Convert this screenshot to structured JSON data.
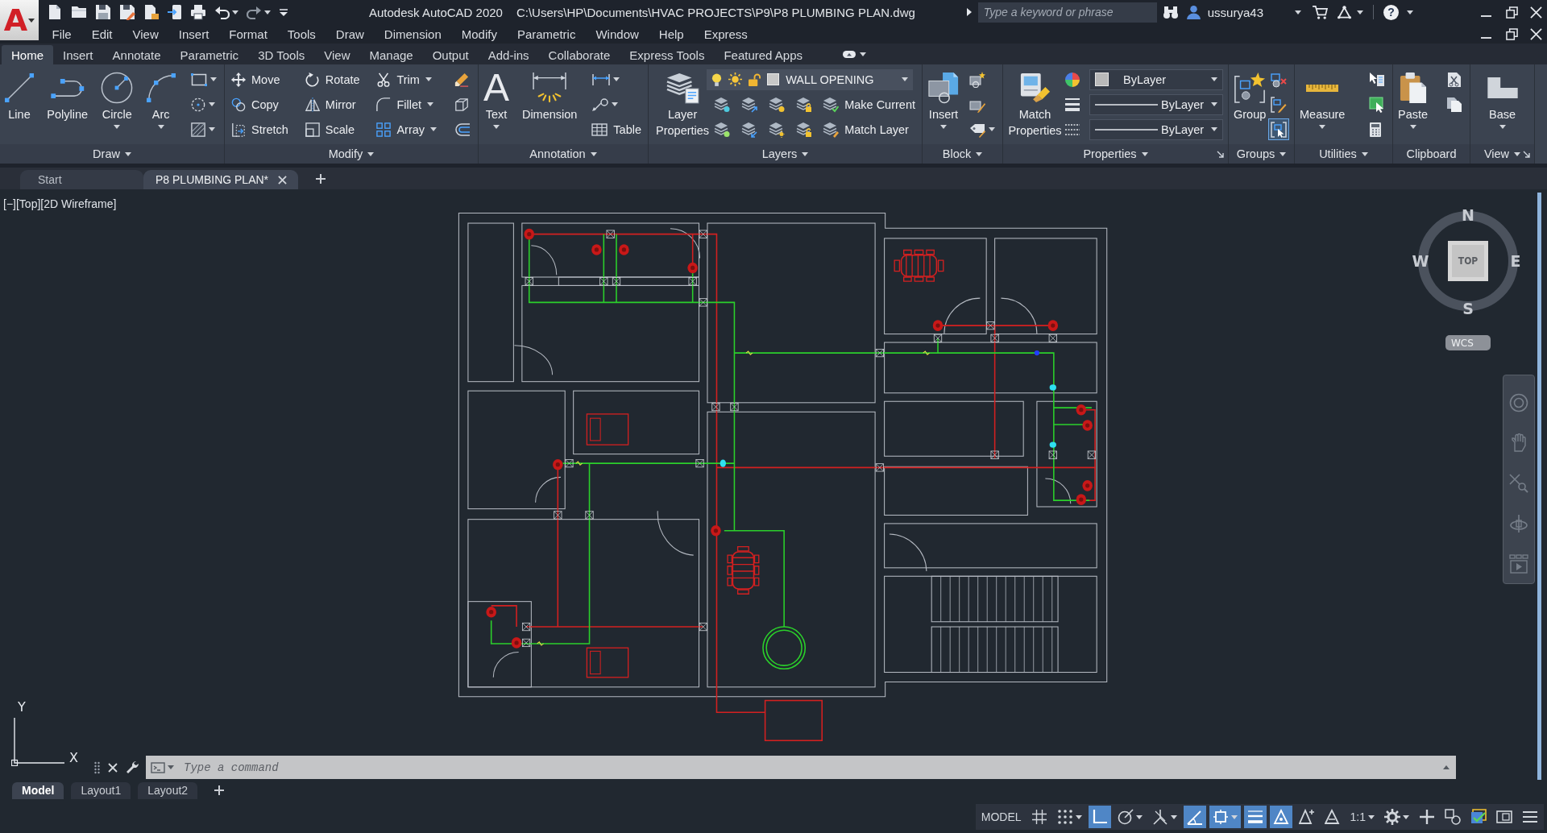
{
  "title_bar": {
    "logo": "A",
    "app_name": "Autodesk AutoCAD 2020",
    "file_path": "C:\\Users\\HP\\Documents\\HVAC PROJECTS\\P9\\P8 PLUMBING PLAN.dwg",
    "search": {
      "placeholder": "Type a keyword or phrase"
    },
    "user": "ussurya43",
    "help": "?"
  },
  "menu_bar": [
    "File",
    "Edit",
    "View",
    "Insert",
    "Format",
    "Tools",
    "Draw",
    "Dimension",
    "Modify",
    "Parametric",
    "Window",
    "Help",
    "Express"
  ],
  "ribbon_tabs": [
    {
      "label": "Home",
      "selected": true
    },
    {
      "label": "Insert",
      "selected": false
    },
    {
      "label": "Annotate",
      "selected": false
    },
    {
      "label": "Parametric",
      "selected": false
    },
    {
      "label": "3D Tools",
      "selected": false
    },
    {
      "label": "View",
      "selected": false
    },
    {
      "label": "Manage",
      "selected": false
    },
    {
      "label": "Output",
      "selected": false
    },
    {
      "label": "Add-ins",
      "selected": false
    },
    {
      "label": "Collaborate",
      "selected": false
    },
    {
      "label": "Express Tools",
      "selected": false
    },
    {
      "label": "Featured Apps",
      "selected": false
    }
  ],
  "ribbon_panels": [
    {
      "title": "Draw",
      "caret": true,
      "launcher": false,
      "columns": [
        {
          "kind": "large",
          "label": "Line",
          "caret": false
        },
        {
          "kind": "large",
          "label": "Polyline",
          "caret": false
        },
        {
          "kind": "large",
          "label": "Circle",
          "caret": true
        },
        {
          "kind": "large",
          "label": "Arc",
          "caret": true
        },
        {
          "kind": "stack",
          "rows": [
            [
              {
                "kind": "icon",
                "caret": true,
                "on": false
              }
            ],
            [
              {
                "kind": "icon",
                "caret": true,
                "on": false
              }
            ],
            [
              {
                "kind": "icon",
                "caret": true,
                "on": false
              }
            ]
          ]
        }
      ]
    },
    {
      "title": "Modify",
      "caret": true,
      "launcher": false,
      "columns": [
        {
          "kind": "stack",
          "rows": [
            [
              {
                "kind": "tool",
                "label": "Move",
                "caret": false
              }
            ],
            [
              {
                "kind": "tool",
                "label": "Copy",
                "caret": false
              }
            ],
            [
              {
                "kind": "tool",
                "label": "Stretch",
                "caret": false
              }
            ]
          ]
        },
        {
          "kind": "stack",
          "rows": [
            [
              {
                "kind": "tool",
                "label": "Rotate",
                "caret": false
              }
            ],
            [
              {
                "kind": "tool",
                "label": "Mirror",
                "caret": false
              }
            ],
            [
              {
                "kind": "tool",
                "label": "Scale",
                "caret": false
              }
            ]
          ]
        },
        {
          "kind": "stack",
          "rows": [
            [
              {
                "kind": "tool",
                "label": "Trim",
                "caret": true
              }
            ],
            [
              {
                "kind": "tool",
                "label": "Fillet",
                "caret": true
              }
            ],
            [
              {
                "kind": "tool",
                "label": "Array",
                "caret": true
              }
            ]
          ]
        },
        {
          "kind": "stack",
          "rows": [
            [
              {
                "kind": "icon",
                "caret": false,
                "on": false
              }
            ],
            [
              {
                "kind": "icon",
                "caret": false,
                "on": false
              }
            ],
            [
              {
                "kind": "icon",
                "caret": false,
                "on": false
              }
            ]
          ]
        }
      ]
    },
    {
      "title": "Annotation",
      "caret": true,
      "launcher": false,
      "columns": [
        {
          "kind": "large",
          "label": "Text",
          "glyph": "A",
          "caret": true
        },
        {
          "kind": "large",
          "label": "Dimension",
          "caret": false
        },
        {
          "kind": "stack",
          "rows": [
            [
              {
                "kind": "icon",
                "caret": true,
                "on": false
              }
            ],
            [
              {
                "kind": "icon",
                "caret": true,
                "on": false
              }
            ],
            [
              {
                "kind": "tool",
                "label": "Table",
                "caret": false
              }
            ]
          ]
        }
      ]
    },
    {
      "title": "Layers",
      "caret": true,
      "launcher": false,
      "columns": [
        {
          "kind": "large",
          "label": "Layer Properties",
          "caret": false
        },
        {
          "kind": "stack",
          "rows": [
            [
              {
                "kind": "combo-layer",
                "value": "WALL OPENING"
              }
            ],
            [
              {
                "kind": "icon",
                "caret": false,
                "on": false
              },
              {
                "kind": "icon",
                "caret": false,
                "on": false
              },
              {
                "kind": "icon",
                "caret": false,
                "on": false
              },
              {
                "kind": "icon",
                "caret": false,
                "on": false
              },
              {
                "kind": "tool",
                "label": "Make Current",
                "caret": false
              }
            ],
            [
              {
                "kind": "icon",
                "caret": false,
                "on": false
              },
              {
                "kind": "icon",
                "caret": false,
                "on": false
              },
              {
                "kind": "icon",
                "caret": false,
                "on": false
              },
              {
                "kind": "icon",
                "caret": false,
                "on": false
              },
              {
                "kind": "tool",
                "label": "Match Layer",
                "caret": false
              }
            ]
          ]
        }
      ]
    },
    {
      "title": "Block",
      "caret": true,
      "launcher": false,
      "columns": [
        {
          "kind": "large",
          "label": "Insert",
          "caret": true
        },
        {
          "kind": "stack",
          "rows": [
            [
              {
                "kind": "icon",
                "caret": false,
                "on": false
              }
            ],
            [
              {
                "kind": "icon",
                "caret": false,
                "on": false
              }
            ],
            [
              {
                "kind": "icon",
                "caret": true,
                "on": false
              }
            ]
          ]
        }
      ]
    },
    {
      "title": "Properties",
      "caret": true,
      "launcher": true,
      "columns": [
        {
          "kind": "large",
          "label": "Match Properties",
          "caret": false
        },
        {
          "kind": "stack",
          "rows": [
            [
              {
                "kind": "icon",
                "caret": false,
                "on": false
              },
              {
                "kind": "combo-swatch",
                "value": "ByLayer"
              }
            ],
            [
              {
                "kind": "icon",
                "caret": false,
                "on": false
              },
              {
                "kind": "combo-line",
                "value": "ByLayer"
              }
            ],
            [
              {
                "kind": "icon",
                "caret": false,
                "on": false
              },
              {
                "kind": "combo-line",
                "value": "ByLayer"
              }
            ]
          ]
        }
      ]
    },
    {
      "title": "Groups",
      "caret": true,
      "launcher": false,
      "columns": [
        {
          "kind": "large",
          "label": "Group",
          "caret": false
        },
        {
          "kind": "stack",
          "rows": [
            [
              {
                "kind": "icon",
                "caret": false,
                "on": false
              }
            ],
            [
              {
                "kind": "icon",
                "caret": false,
                "on": false
              }
            ],
            [
              {
                "kind": "icon",
                "caret": false,
                "on": true
              }
            ]
          ]
        }
      ]
    },
    {
      "title": "Utilities",
      "caret": true,
      "launcher": false,
      "columns": [
        {
          "kind": "large",
          "label": "Measure",
          "caret": true
        },
        {
          "kind": "stack",
          "rows": [
            [
              {
                "kind": "icon",
                "caret": false,
                "on": false
              }
            ],
            [
              {
                "kind": "icon",
                "caret": false,
                "on": false
              }
            ],
            [
              {
                "kind": "icon",
                "caret": false,
                "on": false
              }
            ]
          ]
        }
      ]
    },
    {
      "title": "Clipboard",
      "caret": false,
      "launcher": false,
      "columns": [
        {
          "kind": "large",
          "label": "Paste",
          "caret": true
        },
        {
          "kind": "stack",
          "rows": [
            [
              {
                "kind": "icon",
                "caret": false,
                "on": false
              }
            ],
            [
              {
                "kind": "icon",
                "caret": false,
                "on": false
              }
            ]
          ]
        }
      ]
    },
    {
      "title": "View",
      "caret": true,
      "launcher": true,
      "columns": [
        {
          "kind": "large",
          "label": "Base",
          "caret": true
        }
      ]
    }
  ],
  "file_tabs": [
    {
      "label": "Start",
      "selected": false,
      "closable": false
    },
    {
      "label": "P8 PLUMBING PLAN*",
      "selected": true,
      "closable": true
    }
  ],
  "viewport": {
    "label": "[−][Top][2D Wireframe]",
    "view_cube": {
      "north": "N",
      "east": "E",
      "south": "S",
      "west": "W",
      "face": "TOP",
      "coordinate_system": "WCS"
    },
    "ucs_icon": {
      "x_axis": "X",
      "y_axis": "Y"
    }
  },
  "command_line": {
    "placeholder": "Type a command"
  },
  "layout_tabs": [
    {
      "label": "Model",
      "selected": true
    },
    {
      "label": "Layout1",
      "selected": false
    },
    {
      "label": "Layout2",
      "selected": false
    }
  ],
  "status_bar": [
    {
      "kind": "text",
      "label": "MODEL",
      "on": false,
      "caret": false
    },
    {
      "kind": "icon",
      "on": false,
      "caret": false
    },
    {
      "kind": "icon",
      "on": false,
      "caret": true
    },
    {
      "kind": "icon",
      "on": true,
      "caret": false
    },
    {
      "kind": "icon",
      "on": false,
      "caret": true
    },
    {
      "kind": "icon",
      "on": false,
      "caret": true
    },
    {
      "kind": "icon",
      "on": true,
      "caret": false
    },
    {
      "kind": "icon",
      "on": true,
      "caret": true
    },
    {
      "kind": "icon",
      "on": true,
      "caret": false
    },
    {
      "kind": "icon",
      "on": true,
      "caret": false
    },
    {
      "kind": "icon",
      "on": false,
      "caret": false
    },
    {
      "kind": "icon",
      "on": false,
      "caret": false
    },
    {
      "kind": "text",
      "label": "1:1",
      "on": false,
      "caret": true
    },
    {
      "kind": "icon",
      "on": false,
      "caret": true
    },
    {
      "kind": "icon",
      "on": false,
      "caret": false
    },
    {
      "kind": "icon",
      "on": false,
      "caret": false
    },
    {
      "kind": "icon",
      "on": false,
      "caret": false
    },
    {
      "kind": "icon",
      "on": false,
      "caret": false
    },
    {
      "kind": "icon",
      "on": false,
      "caret": false
    }
  ]
}
